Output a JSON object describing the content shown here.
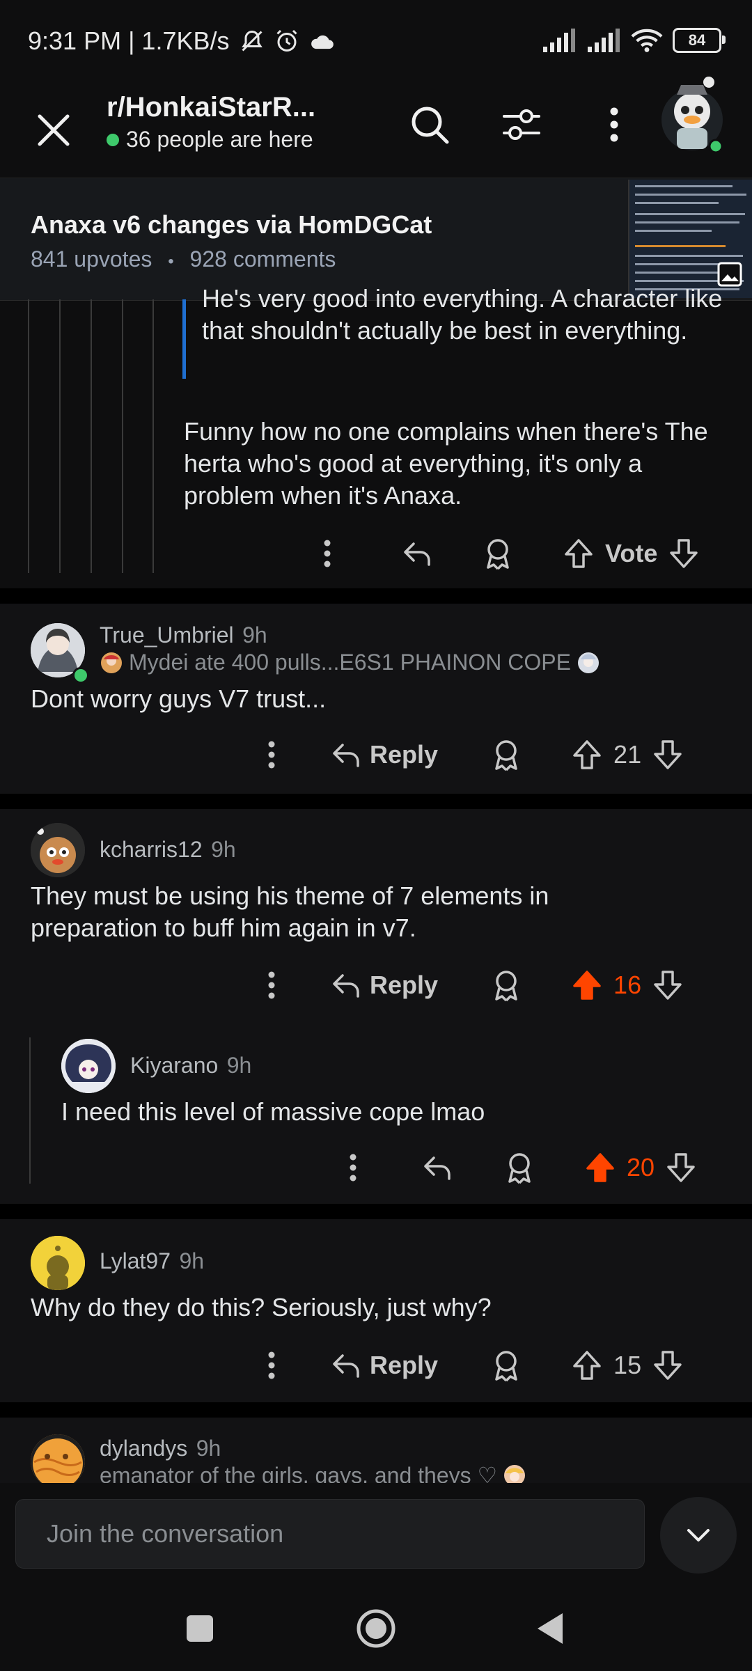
{
  "status": {
    "time_speed": "9:31 PM | 1.7KB/s",
    "battery": "84"
  },
  "topbar": {
    "subreddit": "r/HonkaiStarR...",
    "online": "36 people are here"
  },
  "post": {
    "title": "Anaxa v6 changes via HomDGCat",
    "upvotes": "841 upvotes",
    "dot": "•",
    "comments": "928 comments"
  },
  "comment0": {
    "quote": "He's very good into everything. A character like that shouldn't actually be best in everything.",
    "body": "Funny how no one complains when there's The herta who's good at everything, it's only a problem when it's Anaxa.",
    "vote_label": "Vote"
  },
  "comments": [
    {
      "user": "True_Umbriel",
      "time": "9h",
      "flair": "Mydei ate 400 pulls...E6S1 PHAINON COPE",
      "body": "Dont worry guys V7 trust...",
      "reply": "Reply",
      "votes": "21"
    },
    {
      "user": "kcharris12",
      "time": "9h",
      "body": "They must be using his theme of 7 elements in preparation to buff him again in v7.",
      "reply": "Reply",
      "votes": "16"
    },
    {
      "user": "Kiyarano",
      "time": "9h",
      "body": "I need this level of massive cope lmao",
      "votes": "20"
    },
    {
      "user": "Lylat97",
      "time": "9h",
      "body": "Why do they do this? Seriously, just why?",
      "reply": "Reply",
      "votes": "15"
    },
    {
      "user": "dylandys",
      "time": "9h",
      "flair": "emanator of the girls, gays, and theys ♡"
    }
  ],
  "composer": {
    "placeholder": "Join the conversation"
  },
  "colors": {
    "accent_orange": "#ff4500",
    "online_green": "#3ec96b",
    "quote_bar_blue": "#1f6fd1"
  },
  "icons": [
    "close-icon",
    "search-icon",
    "filter-icon",
    "more-vert-icon",
    "reply-icon",
    "award-icon",
    "upvote-icon",
    "downvote-icon",
    "chevron-down-icon",
    "nav-square-icon",
    "nav-home-icon",
    "nav-back-icon"
  ]
}
